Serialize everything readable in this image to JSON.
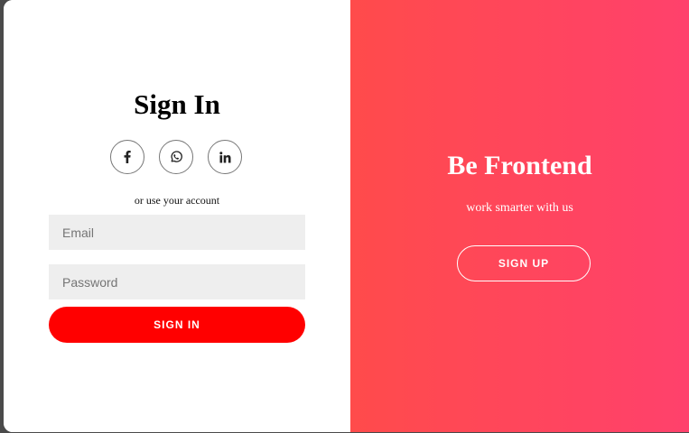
{
  "signin": {
    "title": "Sign In",
    "social": [
      {
        "icon": "facebook-icon"
      },
      {
        "icon": "whatsapp-icon"
      },
      {
        "icon": "linkedin-icon"
      }
    ],
    "hint": "or use your account",
    "email_placeholder": "Email",
    "password_placeholder": "Password",
    "button_label": "SIGN IN"
  },
  "overlay": {
    "title": "Be Frontend",
    "text": "work smarter with us",
    "button_label": "SIGN UP"
  },
  "colors": {
    "primary": "#ff0000",
    "gradient_start": "#ff4b4b",
    "gradient_end": "#ff416c",
    "input_bg": "#eeeeee"
  }
}
